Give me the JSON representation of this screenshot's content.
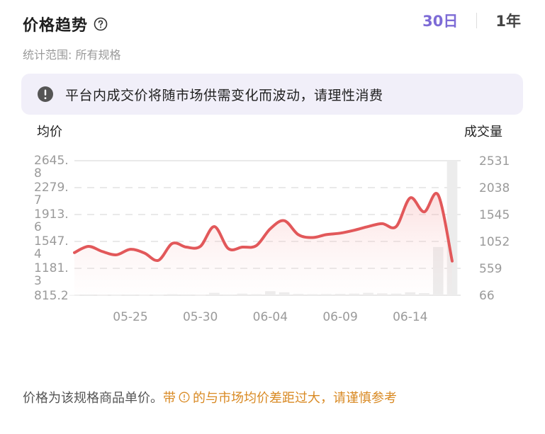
{
  "header": {
    "title": "价格趋势",
    "subtitle": "统计范围: 所有规格",
    "tabs": [
      {
        "label": "30日",
        "active": true
      },
      {
        "label": "1年",
        "active": false
      }
    ]
  },
  "notice": {
    "text": "平台内成交价将随市场供需变化而波动，请理性消费",
    "icon": "exclamation-icon"
  },
  "footer": {
    "prefix": "价格为该规格商品单价。",
    "warn_pre": "带",
    "warn_post": "的与市场均价差距过大，请谨慎参考",
    "warn_color": "#d98a24"
  },
  "chart_data": {
    "type": "line",
    "ylabel": "均价",
    "y2label": "成交量",
    "y_ticks": [
      "2645.\n8",
      "2279.\n7",
      "1913.\n6",
      "1547.\n4",
      "1181.\n3",
      "815.2"
    ],
    "y_ticks_values": [
      2645.8,
      2279.7,
      1913.6,
      1547.4,
      1181.3,
      815.2
    ],
    "ylim": [
      815.2,
      2645.8
    ],
    "y2_ticks": [
      "2531",
      "2038",
      "1545",
      "1052",
      "559",
      "66"
    ],
    "y2lim": [
      66,
      2531
    ],
    "x_ticks": [
      "05-25",
      "05-30",
      "06-04",
      "06-09",
      "06-14"
    ],
    "x_tick_index": [
      4,
      9,
      14,
      19,
      24
    ],
    "line_color": "#e2585a",
    "series": [
      {
        "values": [
          1395,
          1480,
          1410,
          1365,
          1440,
          1390,
          1290,
          1520,
          1470,
          1480,
          1750,
          1450,
          1470,
          1490,
          1720,
          1830,
          1640,
          1600,
          1640,
          1660,
          1700,
          1750,
          1790,
          1750,
          2140,
          1950,
          2180,
          1280
        ]
      }
    ],
    "volume": [
      70,
      80,
      75,
      70,
      78,
      72,
      70,
      85,
      80,
      75,
      110,
      80,
      95,
      85,
      140,
      120,
      90,
      85,
      88,
      92,
      96,
      110,
      100,
      95,
      120,
      105,
      950,
      2531
    ]
  }
}
